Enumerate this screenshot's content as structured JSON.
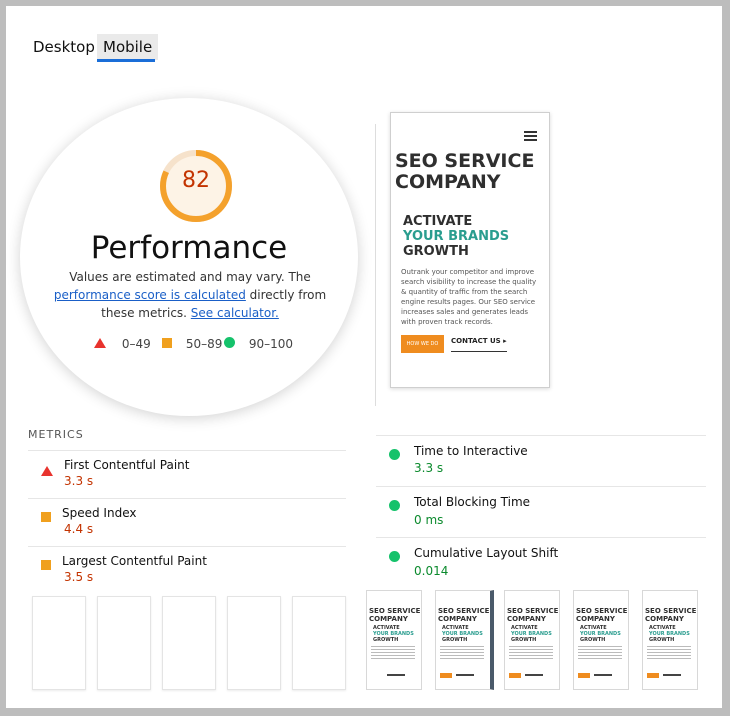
{
  "tabs": [
    {
      "label": "Desktop"
    },
    {
      "label": "Mobile"
    }
  ],
  "gauge": {
    "score": "82",
    "score_value": 0.82,
    "title": "Performance",
    "desc_prefix": "Values are estimated and may vary. The ",
    "desc_link1": "performance score is calculated",
    "desc_middle": " directly from these metrics. ",
    "desc_link2": "See calculator.",
    "legend": [
      {
        "range": "0–49",
        "color": "#e8332e"
      },
      {
        "range": "50–89",
        "color": "#f0a01e"
      },
      {
        "range": "90–100",
        "color": "#15c26b"
      }
    ],
    "gauge_color": "#f4a12c"
  },
  "preview": {
    "title_line1": "SEO SERVICE",
    "title_line2": "COMPANY",
    "sub_line1": "ACTIVATE",
    "sub_line2": "YOUR BRANDS",
    "sub_line3": "GROWTH",
    "body": "Outrank your competitor and improve search visibility to increase the quality & quantity of traffic from the search engine results pages. Our SEO service increases sales and generates leads with proven track records.",
    "button": "HOW WE DO",
    "contact": "CONTACT US ▸"
  },
  "metrics": {
    "heading": "METRICS",
    "left": [
      {
        "label": "First Contentful Paint",
        "value": "3.3 s",
        "status": "fail"
      },
      {
        "label": "Speed Index",
        "value": "4.4 s",
        "status": "average"
      },
      {
        "label": "Largest Contentful Paint",
        "value": "3.5 s",
        "status": "average"
      }
    ],
    "right": [
      {
        "label": "Time to Interactive",
        "value": "3.3 s",
        "status": "pass"
      },
      {
        "label": "Total Blocking Time",
        "value": "0 ms",
        "status": "pass"
      },
      {
        "label": "Cumulative Layout Shift",
        "value": "0.014",
        "status": "pass"
      }
    ]
  },
  "filmstrip": {
    "title_line1": "SEO SERVICE",
    "title_line2": "COMPANY",
    "sub_line1": "ACTIVATE",
    "sub_line2": "YOUR BRANDS",
    "sub_line3": "GROWTH"
  }
}
